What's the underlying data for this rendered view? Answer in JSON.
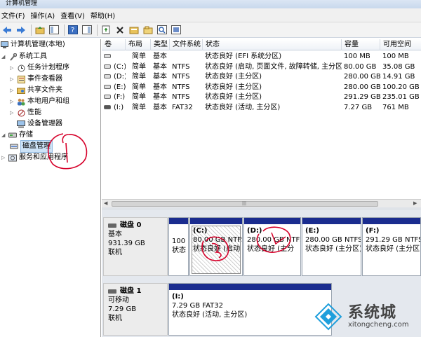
{
  "window": {
    "title": "计算机管理"
  },
  "menu": [
    "文件(F)",
    "操作(A)",
    "查看(V)",
    "帮助(H)"
  ],
  "toolbar": [
    "back-icon",
    "forward-icon",
    "up-folder-icon",
    "show-tree-icon",
    "help-icon",
    "help-pane-icon",
    "connect-icon",
    "delete-icon",
    "properties-icon",
    "open-icon",
    "search-icon",
    "export-icon"
  ],
  "tree": {
    "root": "计算机管理(本地)",
    "system_tools": "系统工具",
    "task_scheduler": "任务计划程序",
    "event_viewer": "事件查看器",
    "shared_folders": "共享文件夹",
    "local_users": "本地用户和组",
    "performance": "性能",
    "device_manager": "设备管理器",
    "storage": "存储",
    "disk_management": "磁盘管理",
    "services_apps": "服务和应用程序"
  },
  "table": {
    "headers": [
      "卷",
      "布局",
      "类型",
      "文件系统",
      "状态",
      "容量",
      "可用空间"
    ],
    "rows": [
      [
        "",
        "简单",
        "基本",
        "",
        "状态良好 (EFI 系统分区)",
        "100 MB",
        "100 MB"
      ],
      [
        "(C:)",
        "简单",
        "基本",
        "NTFS",
        "状态良好 (启动, 页面文件, 故障转储, 主分区)",
        "80.00 GB",
        "35.08 GB"
      ],
      [
        "(D:)",
        "简单",
        "基本",
        "NTFS",
        "状态良好 (主分区)",
        "280.00 GB",
        "14.91 GB"
      ],
      [
        "(E:)",
        "简单",
        "基本",
        "NTFS",
        "状态良好 (主分区)",
        "280.00 GB",
        "100.20 GB"
      ],
      [
        "(F:)",
        "简单",
        "基本",
        "NTFS",
        "状态良好 (主分区)",
        "291.29 GB",
        "235.01 GB"
      ],
      [
        "(I:)",
        "简单",
        "基本",
        "FAT32",
        "状态良好 (活动, 主分区)",
        "7.27 GB",
        "761 MB"
      ]
    ]
  },
  "disk0": {
    "name": "磁盘 0",
    "type": "基本",
    "size": "931.39 GB",
    "status": "联机",
    "partitions": [
      {
        "label": "",
        "line1": "100",
        "line2": "状态"
      },
      {
        "label": "(C:)",
        "line1": "80.00 GB NTFS",
        "line2": "状态良好 (启动"
      },
      {
        "label": "(D:)",
        "line1": "280.00 GB NTFS",
        "line2": "状态良好 (主分"
      },
      {
        "label": "(E:)",
        "line1": "280.00 GB NTFS",
        "line2": "状态良好 (主分区)"
      },
      {
        "label": "(F:)",
        "line1": "291.29 GB NTFS",
        "line2": "状态良好 (主分区"
      }
    ]
  },
  "disk1": {
    "name": "磁盘 1",
    "type": "可移动",
    "size": "7.29 GB",
    "status": "联机",
    "partition": {
      "label": "(I:)",
      "line1": "7.29 GB FAT32",
      "line2": "状态良好 (活动, 主分区)"
    }
  },
  "watermark": {
    "title": "系统城",
    "url": "xitongcheng.com"
  }
}
